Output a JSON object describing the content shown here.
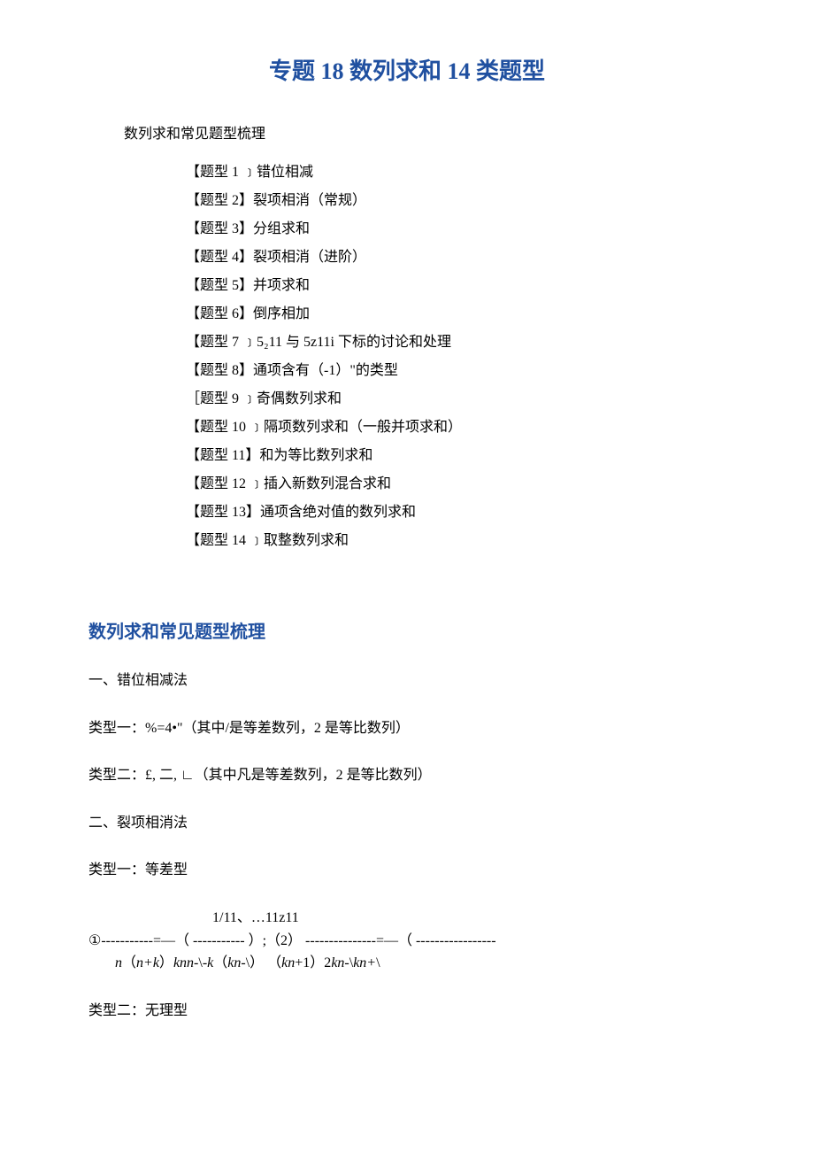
{
  "title": "专题 18 数列求和 14 类题型",
  "toc_header": "数列求和常见题型梳理",
  "toc": [
    "【题型 1 ﹞错位相减",
    "【题型 2】裂项相消（常规）",
    "【题型 3】分组求和",
    "【题型 4】裂项相消（进阶）",
    "【题型 5】并项求和",
    "【题型 6】倒序相加",
    "【题型 7 ﹞5₂11 与 5z11i 下标的讨论和处理",
    "【题型 8】通项含有（-1）\"的类型",
    "［题型 9 ﹞奇偶数列求和",
    "【题型 10 ﹞隔项数列求和（一般并项求和）",
    "【题型 11】和为等比数列求和",
    "【题型 12 ﹞插入新数列混合求和",
    "【题型 13】通项含绝对值的数列求和",
    "【题型 14 ﹞取整数列求和"
  ],
  "section_title": "数列求和常见题型梳理",
  "p1": "一、错位相减法",
  "p2": "类型一：%=4•\"（其中/是等差数列，2 是等比数列）",
  "p3": "类型二：£, 二, ∟（其中凡是等差数列，2 是等比数列）",
  "p4": "二、裂项相消法",
  "p5": "类型一：等差型",
  "formula_top": "1/11、…11z11",
  "formula_bottom": "①-----------=—（ ----------- ）;（2） ---------------=—（ -----------------",
  "formula_line3_prefix": "n （n+k）knn-\\-k（kn-\\） （kn+1）2kn-\\kn+\\",
  "p6": "类型二：无理型"
}
